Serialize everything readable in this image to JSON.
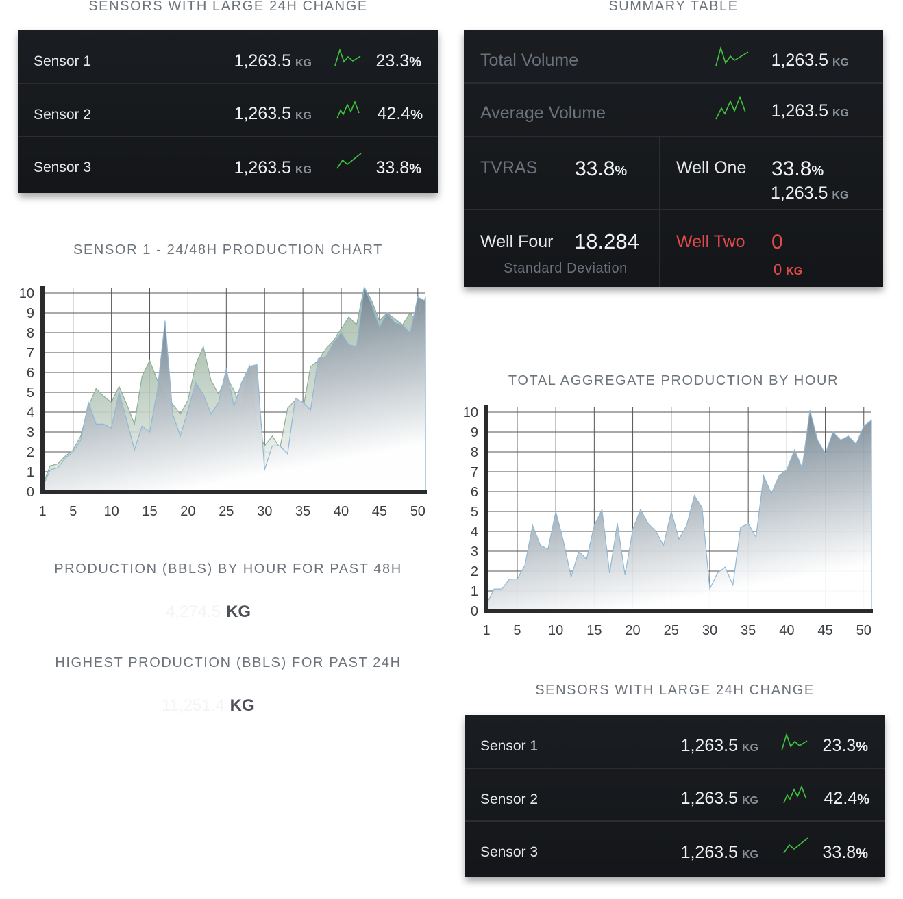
{
  "left_sensors": {
    "title": "SENSORS WITH LARGE 24H CHANGE",
    "rows": [
      {
        "label": "Sensor 1",
        "value": "1,263.5",
        "unit": "KG",
        "pct": "23.3",
        "pct_sign": "%",
        "spark_icon": "trend-zigzag-icon"
      },
      {
        "label": "Sensor 2",
        "value": "1,263.5",
        "unit": "KG",
        "pct": "42.4",
        "pct_sign": "%",
        "spark_icon": "trend-peaks-icon"
      },
      {
        "label": "Sensor 3",
        "value": "1,263.5",
        "unit": "KG",
        "pct": "33.8",
        "pct_sign": "%",
        "spark_icon": "trend-check-icon"
      }
    ]
  },
  "summary": {
    "title": "SUMMARY TABLE",
    "total_volume": {
      "label": "Total Volume",
      "value": "1,263.5",
      "unit": "KG"
    },
    "average_volume": {
      "label": "Average Volume",
      "value": "1,263.5",
      "unit": "KG"
    },
    "tvras": {
      "label": "TVRAS",
      "value": "33.8",
      "pct_sign": "%"
    },
    "well_one": {
      "label": "Well One",
      "value": "33.8",
      "pct_sign": "%",
      "sub_value": "1,263.5",
      "sub_unit": "KG"
    },
    "well_four": {
      "label": "Well Four",
      "value": "18.284",
      "caption": "Standard Deviation"
    },
    "well_two": {
      "label": "Well Two",
      "value": "0",
      "sub_value": "0",
      "sub_unit": "KG"
    }
  },
  "sensor1_chart": {
    "title": "SENSOR 1 - 24/48H PRODUCTION CHART"
  },
  "production": {
    "title": "PRODUCTION (BBLS) BY HOUR FOR PAST 48H",
    "value": "4,274.5",
    "unit": "KG"
  },
  "highest": {
    "title": "HIGHEST PRODUCTION (BBLS) FOR PAST 24H",
    "value": "11,251.4",
    "unit": "KG"
  },
  "aggregate_chart": {
    "title": "TOTAL AGGREGATE PRODUCTION BY HOUR"
  },
  "bottom_sensors": {
    "title": "SENSORS WITH LARGE 24H CHANGE",
    "rows": [
      {
        "label": "Sensor 1",
        "value": "1,263.5",
        "unit": "KG",
        "pct": "23.3",
        "pct_sign": "%",
        "spark_icon": "trend-zigzag-icon"
      },
      {
        "label": "Sensor 2",
        "value": "1,263.5",
        "unit": "KG",
        "pct": "42.4",
        "pct_sign": "%",
        "spark_icon": "trend-peaks-icon"
      },
      {
        "label": "Sensor 3",
        "value": "1,263.5",
        "unit": "KG",
        "pct": "33.8",
        "pct_sign": "%",
        "spark_icon": "trend-check-icon"
      }
    ]
  },
  "colors": {
    "panel_bg": "#16191c",
    "spark_green": "#3fc43f",
    "alert_red": "#e24a4a",
    "area_dark": "#3f5667",
    "area_green": "#7a9c82"
  },
  "chart_data": [
    {
      "type": "area",
      "x": [
        1,
        2,
        3,
        4,
        5,
        6,
        7,
        8,
        9,
        10,
        11,
        12,
        13,
        14,
        15,
        16,
        17,
        18,
        19,
        20,
        21,
        22,
        23,
        24,
        25,
        26,
        27,
        28,
        29,
        30,
        31,
        32,
        33,
        34,
        35,
        36,
        37,
        38,
        39,
        40,
        41,
        42,
        43,
        44,
        45,
        46,
        47,
        48,
        49,
        50,
        51
      ],
      "series": [
        {
          "values": [
            0.3,
            1.3,
            1.4,
            1.8,
            2.1,
            2.8,
            4.3,
            5.2,
            4.8,
            4.5,
            5.3,
            4.4,
            3.4,
            5.8,
            6.6,
            5.6,
            4.9,
            4.4,
            3.9,
            4.6,
            6.4,
            7.3,
            5.6,
            4.9,
            5.8,
            5.1,
            4.1,
            6.4,
            3.2,
            2.3,
            2.8,
            2.2,
            4.2,
            4.6,
            4.1,
            6.3,
            6.6,
            7.2,
            7.6,
            8.2,
            8.8,
            8.4,
            10.3,
            9.6,
            8.6,
            9.0,
            8.7,
            8.4,
            9.0,
            8.5,
            9.8
          ]
        },
        {
          "values": [
            0.2,
            1.1,
            1.2,
            1.7,
            2.0,
            2.6,
            4.5,
            3.4,
            3.4,
            3.2,
            5.0,
            3.6,
            2.1,
            3.3,
            3.0,
            5.1,
            8.6,
            3.9,
            2.8,
            4.1,
            5.5,
            4.9,
            3.9,
            4.5,
            6.2,
            4.3,
            5.5,
            6.3,
            6.4,
            1.1,
            2.3,
            2.3,
            1.9,
            4.7,
            4.5,
            4.1,
            6.7,
            6.8,
            7.5,
            8.0,
            7.4,
            7.3,
            10.3,
            9.4,
            8.3,
            9.0,
            8.5,
            8.4,
            8.0,
            9.8,
            9.6
          ]
        }
      ],
      "xticks": [
        1,
        5,
        10,
        15,
        20,
        25,
        30,
        35,
        40,
        45,
        50
      ],
      "ylim": [
        0,
        10
      ],
      "grid": true
    },
    {
      "type": "area",
      "x": [
        1,
        2,
        3,
        4,
        5,
        6,
        7,
        8,
        9,
        10,
        11,
        12,
        13,
        14,
        15,
        16,
        17,
        18,
        19,
        20,
        21,
        22,
        23,
        24,
        25,
        26,
        27,
        28,
        29,
        30,
        31,
        32,
        33,
        34,
        35,
        36,
        37,
        38,
        39,
        40,
        41,
        42,
        43,
        44,
        45,
        46,
        47,
        48,
        49,
        50,
        51
      ],
      "series": [
        {
          "values": [
            0.3,
            1.1,
            1.1,
            1.6,
            1.6,
            2.3,
            4.3,
            3.3,
            3.1,
            5.0,
            3.5,
            1.7,
            3.0,
            2.6,
            4.3,
            5.1,
            1.9,
            4.4,
            1.8,
            4.1,
            5.1,
            4.4,
            4.0,
            3.3,
            5.0,
            3.6,
            4.3,
            5.8,
            5.2,
            1.1,
            1.9,
            2.2,
            1.3,
            4.2,
            4.4,
            3.7,
            6.8,
            5.9,
            6.8,
            7.1,
            8.1,
            7.2,
            10.1,
            8.6,
            7.9,
            9.0,
            8.6,
            8.8,
            8.4,
            9.3,
            9.6
          ]
        }
      ],
      "xticks": [
        1,
        5,
        10,
        15,
        20,
        25,
        30,
        35,
        40,
        45,
        50
      ],
      "ylim": [
        0,
        10
      ],
      "grid": true
    }
  ]
}
